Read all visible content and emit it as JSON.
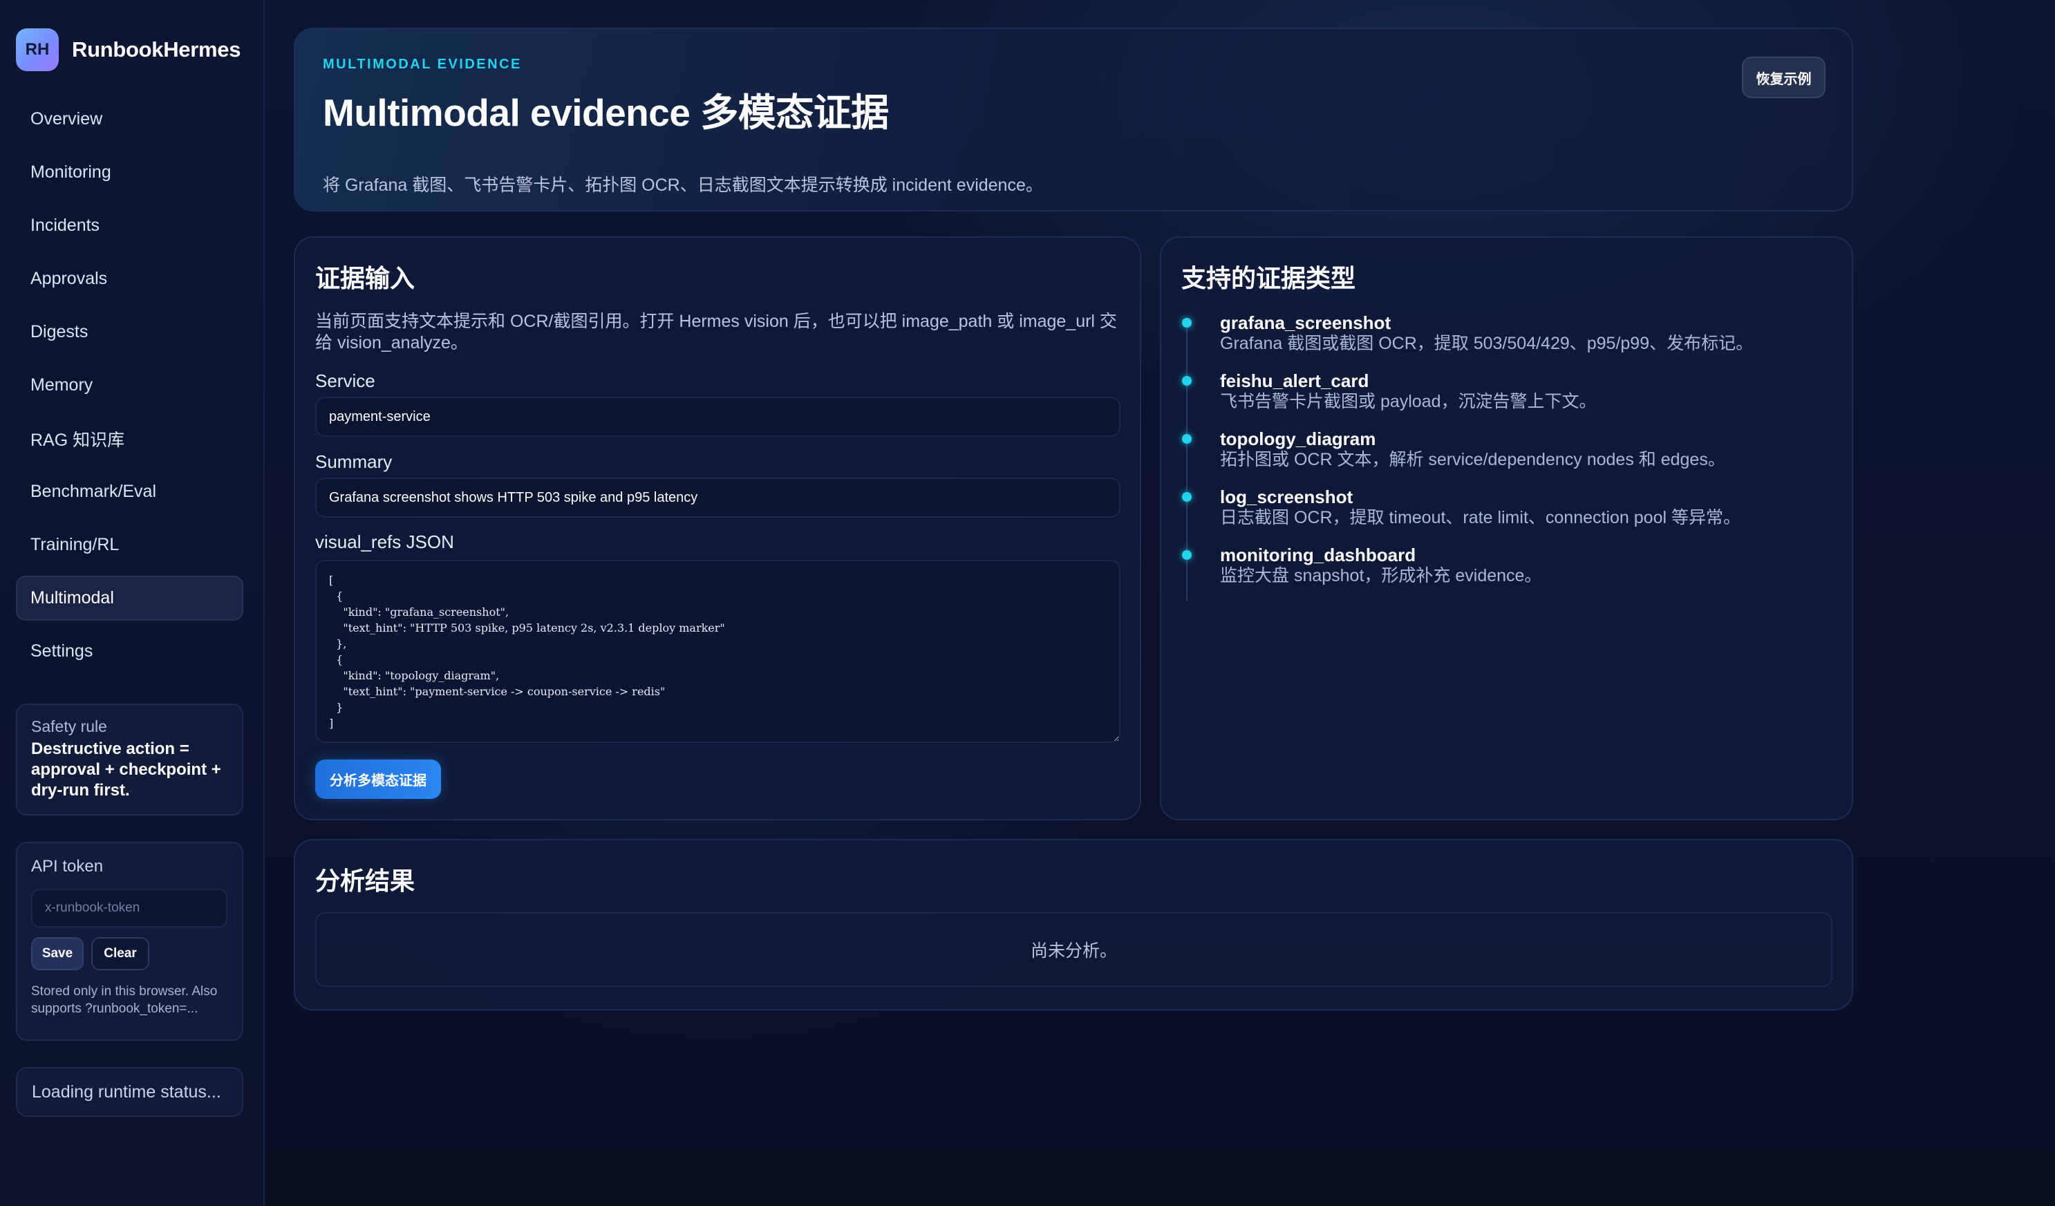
{
  "brand": {
    "logo": "RH",
    "name": "RunbookHermes"
  },
  "nav": {
    "items": [
      {
        "label": "Overview"
      },
      {
        "label": "Monitoring"
      },
      {
        "label": "Incidents"
      },
      {
        "label": "Approvals"
      },
      {
        "label": "Digests"
      },
      {
        "label": "Memory"
      },
      {
        "label": "RAG 知识库"
      },
      {
        "label": "Benchmark/Eval"
      },
      {
        "label": "Training/RL"
      },
      {
        "label": "Multimodal"
      },
      {
        "label": "Settings"
      }
    ],
    "active": "Multimodal"
  },
  "safety": {
    "label": "Safety rule",
    "text": "Destructive action = approval + checkpoint + dry-run first."
  },
  "api_token": {
    "label": "API token",
    "placeholder": "x-runbook-token",
    "value": "",
    "save_label": "Save",
    "clear_label": "Clear",
    "note": "Stored only in this browser. Also supports ?runbook_token=..."
  },
  "runtime_status": "Loading runtime status...",
  "hero": {
    "eyebrow": "MULTIMODAL EVIDENCE",
    "title": "Multimodal evidence 多模态证据",
    "subtitle": "将 Grafana 截图、飞书告警卡片、拓扑图 OCR、日志截图文本提示转换成 incident evidence。",
    "restore_label": "恢复示例"
  },
  "evidence_input": {
    "title": "证据输入",
    "intro": "当前页面支持文本提示和 OCR/截图引用。打开 Hermes vision 后，也可以把 image_path 或 image_url 交给 vision_analyze。",
    "service_label": "Service",
    "service_value": "payment-service",
    "summary_label": "Summary",
    "summary_value": "Grafana screenshot shows HTTP 503 spike and p95 latency",
    "visual_refs_label": "visual_refs JSON",
    "visual_refs_value": "[\n  {\n    \"kind\": \"grafana_screenshot\",\n    \"text_hint\": \"HTTP 503 spike, p95 latency 2s, v2.3.1 deploy marker\"\n  },\n  {\n    \"kind\": \"topology_diagram\",\n    \"text_hint\": \"payment-service -> coupon-service -> redis\"\n  }\n]",
    "analyze_label": "分析多模态证据"
  },
  "supported_types": {
    "title": "支持的证据类型",
    "items": [
      {
        "kind": "grafana_screenshot",
        "desc": "Grafana 截图或截图 OCR，提取 503/504/429、p95/p99、发布标记。"
      },
      {
        "kind": "feishu_alert_card",
        "desc": "飞书告警卡片截图或 payload，沉淀告警上下文。"
      },
      {
        "kind": "topology_diagram",
        "desc": "拓扑图或 OCR 文本，解析 service/dependency nodes 和 edges。"
      },
      {
        "kind": "log_screenshot",
        "desc": "日志截图 OCR，提取 timeout、rate limit、connection pool 等异常。"
      },
      {
        "kind": "monitoring_dashboard",
        "desc": "监控大盘 snapshot，形成补充 evidence。"
      }
    ]
  },
  "results": {
    "title": "分析结果",
    "empty_text": "尚未分析。"
  },
  "colors": {
    "accent": "#22d3ee",
    "primary_button": "#2b86f0",
    "background": "#0a1226",
    "panel": "#101b3a"
  },
  "icons": {
    "logo": "rh-logo-icon",
    "timeline_dot": "cyan-dot-icon"
  }
}
